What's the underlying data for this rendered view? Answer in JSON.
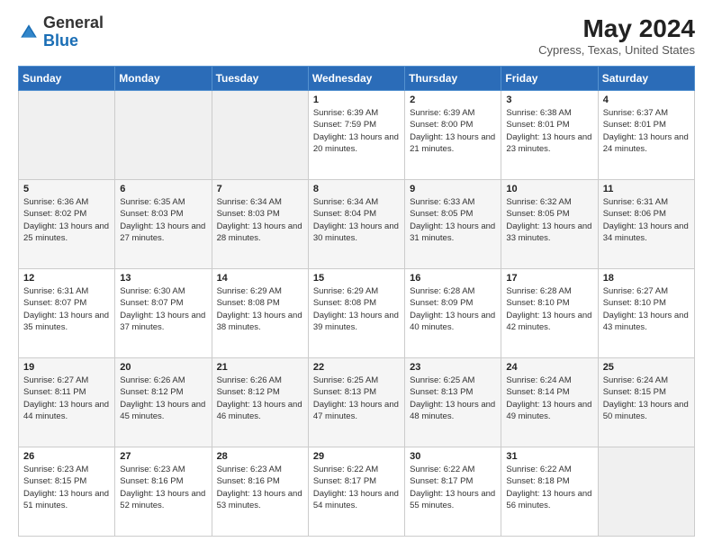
{
  "header": {
    "logo_general": "General",
    "logo_blue": "Blue",
    "month_year": "May 2024",
    "location": "Cypress, Texas, United States"
  },
  "days_of_week": [
    "Sunday",
    "Monday",
    "Tuesday",
    "Wednesday",
    "Thursday",
    "Friday",
    "Saturday"
  ],
  "weeks": [
    [
      {
        "day": "",
        "info": ""
      },
      {
        "day": "",
        "info": ""
      },
      {
        "day": "",
        "info": ""
      },
      {
        "day": "1",
        "info": "Sunrise: 6:39 AM\nSunset: 7:59 PM\nDaylight: 13 hours and 20 minutes."
      },
      {
        "day": "2",
        "info": "Sunrise: 6:39 AM\nSunset: 8:00 PM\nDaylight: 13 hours and 21 minutes."
      },
      {
        "day": "3",
        "info": "Sunrise: 6:38 AM\nSunset: 8:01 PM\nDaylight: 13 hours and 23 minutes."
      },
      {
        "day": "4",
        "info": "Sunrise: 6:37 AM\nSunset: 8:01 PM\nDaylight: 13 hours and 24 minutes."
      }
    ],
    [
      {
        "day": "5",
        "info": "Sunrise: 6:36 AM\nSunset: 8:02 PM\nDaylight: 13 hours and 25 minutes."
      },
      {
        "day": "6",
        "info": "Sunrise: 6:35 AM\nSunset: 8:03 PM\nDaylight: 13 hours and 27 minutes."
      },
      {
        "day": "7",
        "info": "Sunrise: 6:34 AM\nSunset: 8:03 PM\nDaylight: 13 hours and 28 minutes."
      },
      {
        "day": "8",
        "info": "Sunrise: 6:34 AM\nSunset: 8:04 PM\nDaylight: 13 hours and 30 minutes."
      },
      {
        "day": "9",
        "info": "Sunrise: 6:33 AM\nSunset: 8:05 PM\nDaylight: 13 hours and 31 minutes."
      },
      {
        "day": "10",
        "info": "Sunrise: 6:32 AM\nSunset: 8:05 PM\nDaylight: 13 hours and 33 minutes."
      },
      {
        "day": "11",
        "info": "Sunrise: 6:31 AM\nSunset: 8:06 PM\nDaylight: 13 hours and 34 minutes."
      }
    ],
    [
      {
        "day": "12",
        "info": "Sunrise: 6:31 AM\nSunset: 8:07 PM\nDaylight: 13 hours and 35 minutes."
      },
      {
        "day": "13",
        "info": "Sunrise: 6:30 AM\nSunset: 8:07 PM\nDaylight: 13 hours and 37 minutes."
      },
      {
        "day": "14",
        "info": "Sunrise: 6:29 AM\nSunset: 8:08 PM\nDaylight: 13 hours and 38 minutes."
      },
      {
        "day": "15",
        "info": "Sunrise: 6:29 AM\nSunset: 8:08 PM\nDaylight: 13 hours and 39 minutes."
      },
      {
        "day": "16",
        "info": "Sunrise: 6:28 AM\nSunset: 8:09 PM\nDaylight: 13 hours and 40 minutes."
      },
      {
        "day": "17",
        "info": "Sunrise: 6:28 AM\nSunset: 8:10 PM\nDaylight: 13 hours and 42 minutes."
      },
      {
        "day": "18",
        "info": "Sunrise: 6:27 AM\nSunset: 8:10 PM\nDaylight: 13 hours and 43 minutes."
      }
    ],
    [
      {
        "day": "19",
        "info": "Sunrise: 6:27 AM\nSunset: 8:11 PM\nDaylight: 13 hours and 44 minutes."
      },
      {
        "day": "20",
        "info": "Sunrise: 6:26 AM\nSunset: 8:12 PM\nDaylight: 13 hours and 45 minutes."
      },
      {
        "day": "21",
        "info": "Sunrise: 6:26 AM\nSunset: 8:12 PM\nDaylight: 13 hours and 46 minutes."
      },
      {
        "day": "22",
        "info": "Sunrise: 6:25 AM\nSunset: 8:13 PM\nDaylight: 13 hours and 47 minutes."
      },
      {
        "day": "23",
        "info": "Sunrise: 6:25 AM\nSunset: 8:13 PM\nDaylight: 13 hours and 48 minutes."
      },
      {
        "day": "24",
        "info": "Sunrise: 6:24 AM\nSunset: 8:14 PM\nDaylight: 13 hours and 49 minutes."
      },
      {
        "day": "25",
        "info": "Sunrise: 6:24 AM\nSunset: 8:15 PM\nDaylight: 13 hours and 50 minutes."
      }
    ],
    [
      {
        "day": "26",
        "info": "Sunrise: 6:23 AM\nSunset: 8:15 PM\nDaylight: 13 hours and 51 minutes."
      },
      {
        "day": "27",
        "info": "Sunrise: 6:23 AM\nSunset: 8:16 PM\nDaylight: 13 hours and 52 minutes."
      },
      {
        "day": "28",
        "info": "Sunrise: 6:23 AM\nSunset: 8:16 PM\nDaylight: 13 hours and 53 minutes."
      },
      {
        "day": "29",
        "info": "Sunrise: 6:22 AM\nSunset: 8:17 PM\nDaylight: 13 hours and 54 minutes."
      },
      {
        "day": "30",
        "info": "Sunrise: 6:22 AM\nSunset: 8:17 PM\nDaylight: 13 hours and 55 minutes."
      },
      {
        "day": "31",
        "info": "Sunrise: 6:22 AM\nSunset: 8:18 PM\nDaylight: 13 hours and 56 minutes."
      },
      {
        "day": "",
        "info": ""
      }
    ]
  ]
}
